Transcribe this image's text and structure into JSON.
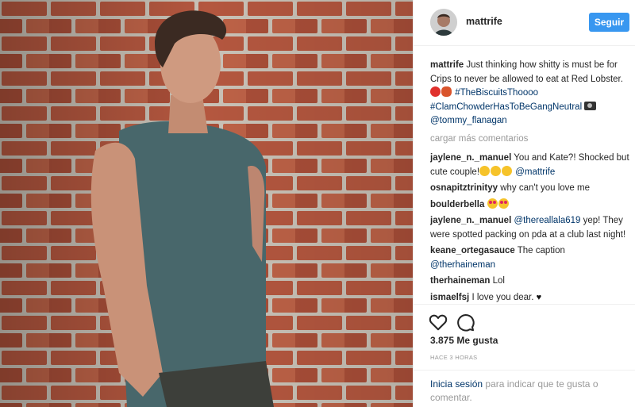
{
  "post": {
    "photo_alt": "",
    "header": {
      "username": "mattrife",
      "follow_label": "Seguir"
    },
    "caption": {
      "username": "mattrife",
      "text_1": "Just thinking how shitty is must be for Crips to never be allowed to eat at Red Lobster.",
      "tag_1": "#TheBiscuitsThoooo",
      "tag_2": "#ClamChowderHasToBeGangNeutral",
      "mention": "@tommy_flanagan"
    },
    "load_more": "cargar más comentarios",
    "comments": [
      {
        "user": "jaylene_n._manuel",
        "text": "You and Kate?! Shocked but cute couple!",
        "mention": "@mattrife"
      },
      {
        "user": "osnapitztrinityy",
        "text": "why can't you love me"
      },
      {
        "user": "boulderbella",
        "text": ""
      },
      {
        "user": "jaylene_n._manuel",
        "mention": "@thereallala619",
        "text": "yep! They were spotted packing on pda at a club last night!"
      },
      {
        "user": "keane_ortegasauce",
        "text": "The caption",
        "mention": "@therhaineman"
      },
      {
        "user": "therhaineman",
        "text": "Lol"
      },
      {
        "user": "ismaelfsj",
        "text": "I love you dear."
      }
    ],
    "icons": {
      "like": "heart-icon",
      "comment": "comment-icon"
    },
    "likes": "3.875 Me gusta",
    "timestamp": "HACE 3 HORAS",
    "login": {
      "link": "Inicia sesión",
      "rest": "para indicar que te gusta o comentar."
    },
    "colors": {
      "follow_button": "#3897f0",
      "link": "#003569",
      "muted": "#999999"
    }
  }
}
